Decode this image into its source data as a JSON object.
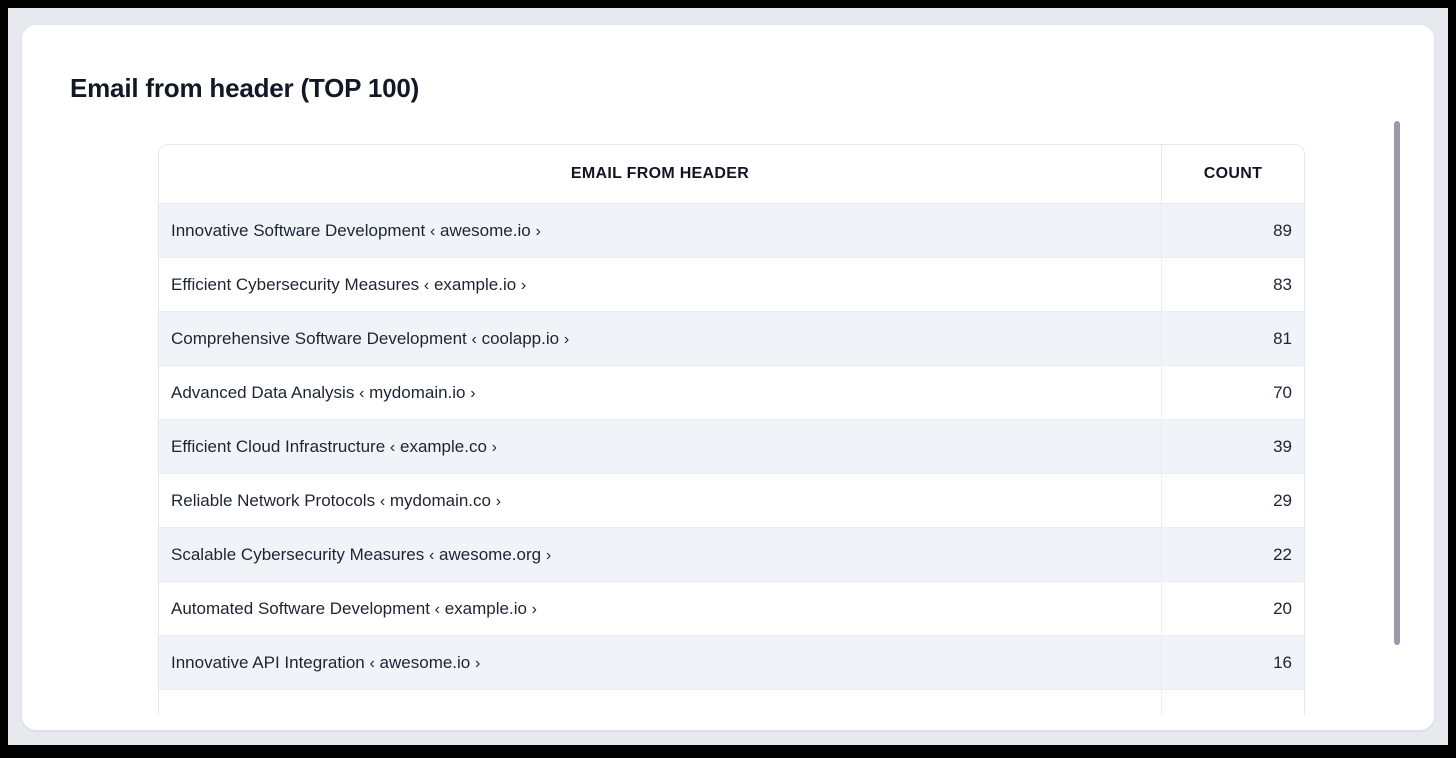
{
  "card": {
    "title": "Email from header (TOP 100)"
  },
  "table": {
    "columns": [
      {
        "key": "email_from_header",
        "label": "EMAIL FROM HEADER",
        "align": "center"
      },
      {
        "key": "count",
        "label": "COUNT",
        "align": "center"
      }
    ],
    "rows": [
      {
        "name": "Innovative Software Development",
        "domain": "awesome.io",
        "count": "89"
      },
      {
        "name": "Efficient Cybersecurity Measures",
        "domain": "example.io",
        "count": "83"
      },
      {
        "name": "Comprehensive Software Development",
        "domain": "coolapp.io",
        "count": "81"
      },
      {
        "name": "Advanced Data Analysis",
        "domain": "mydomain.io",
        "count": "70"
      },
      {
        "name": "Efficient Cloud Infrastructure",
        "domain": "example.co",
        "count": "39"
      },
      {
        "name": "Reliable Network Protocols",
        "domain": "mydomain.co",
        "count": "29"
      },
      {
        "name": "Scalable Cybersecurity Measures",
        "domain": "awesome.org",
        "count": "22"
      },
      {
        "name": "Automated Software Development",
        "domain": "example.io",
        "count": "20"
      },
      {
        "name": "Innovative API Integration",
        "domain": "awesome.io",
        "count": "16"
      },
      {
        "name": "",
        "domain": "",
        "count": ""
      }
    ],
    "bracket_open": "‹",
    "bracket_close": "›"
  },
  "scrollbar": {
    "name": "vertical-scrollbar",
    "thumb_color": "#9a9aaf"
  },
  "colors": {
    "page_background": "#e6eaef",
    "frame": "#000000",
    "card_background": "#ffffff",
    "row_stripe": "#f0f4f9",
    "border": "#e4e9f0",
    "text": "#1d2433",
    "title": "#121826"
  }
}
